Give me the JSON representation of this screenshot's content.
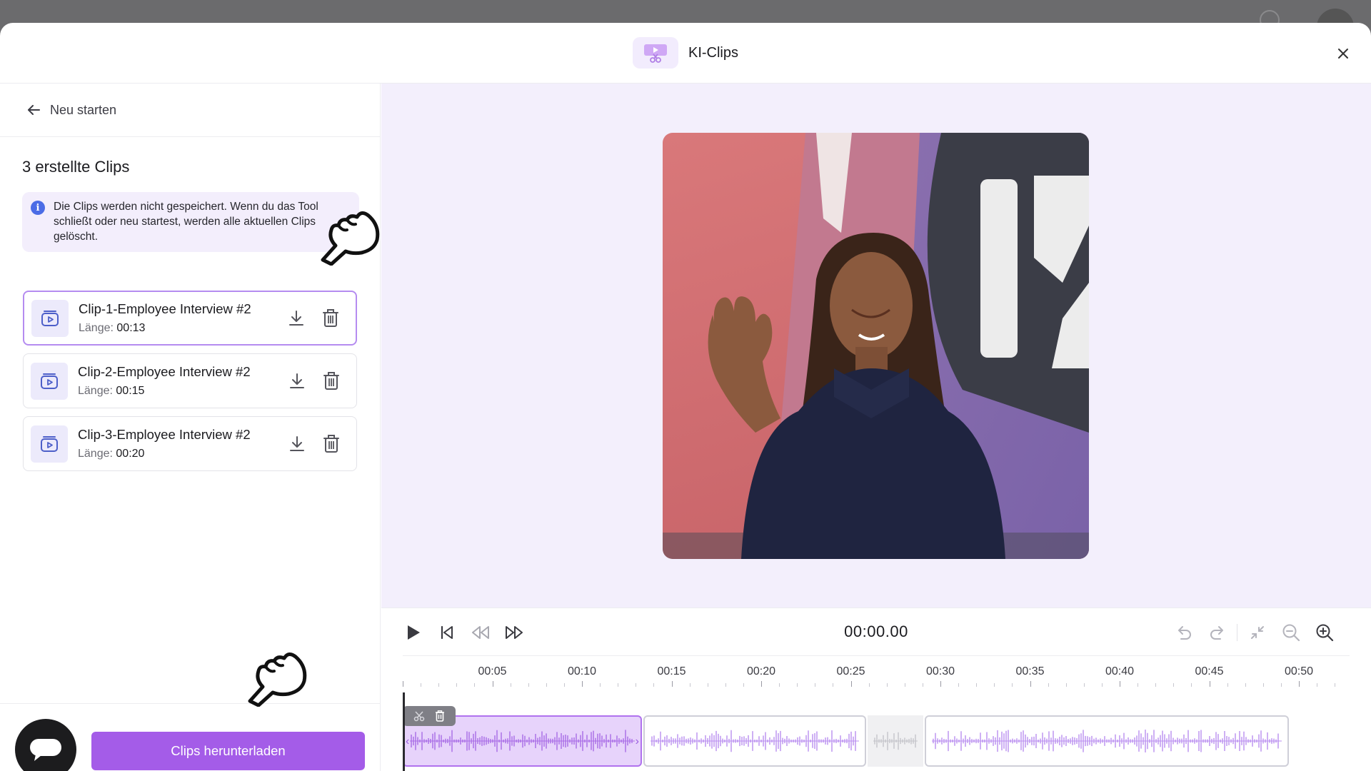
{
  "header": {
    "title": "KI-Clips"
  },
  "sidebar": {
    "back_label": "Neu starten",
    "section_title": "3 erstellte Clips",
    "info_text": "Die Clips werden nicht gespeichert. Wenn du das Tool schließt oder neu startest, werden alle aktuellen Clips gelöscht.",
    "length_label": "Länge:",
    "clips": [
      {
        "name": "Clip-1-Employee Interview #2",
        "length": "00:13",
        "selected": true
      },
      {
        "name": "Clip-2-Employee Interview #2",
        "length": "00:15",
        "selected": false
      },
      {
        "name": "Clip-3-Employee Interview #2",
        "length": "00:20",
        "selected": false
      }
    ],
    "download_all_label": "Clips herunterladen"
  },
  "player": {
    "timecode": "00:00.00"
  },
  "timeline": {
    "tick_labels": [
      "00:05",
      "00:10",
      "00:15",
      "00:20",
      "00:25",
      "00:30",
      "00:35",
      "00:40",
      "00:45",
      "00:50"
    ]
  },
  "colors": {
    "accent": "#a45ce8",
    "accent_light": "#e7d3fb",
    "stage_bg": "#f3effc",
    "info_bg": "#f3eefc"
  },
  "icons": [
    "film-scissors-icon",
    "close-icon",
    "arrow-left-icon",
    "info-icon",
    "video-clip-icon",
    "download-icon",
    "trash-icon",
    "chat-icon",
    "play-icon",
    "skip-back-icon",
    "rewind-icon",
    "fast-forward-icon",
    "undo-icon",
    "redo-icon",
    "collapse-icon",
    "zoom-out-icon",
    "zoom-in-icon",
    "scissors-icon",
    "pointing-hand-icon"
  ]
}
